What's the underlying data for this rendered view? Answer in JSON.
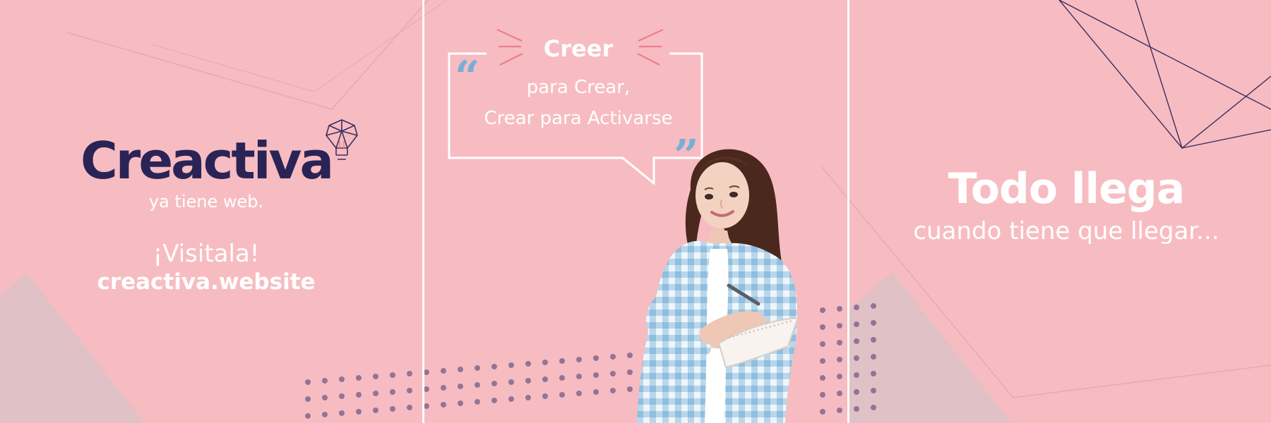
{
  "palette": {
    "background": "#f7bcc1",
    "brand": "#2a2456",
    "text": "#ffffff",
    "quote": "#78afd6",
    "dot": "#8a6d8f",
    "lines": "#3a2f5d"
  },
  "left_panel": {
    "brand": "Creactiva",
    "tagline": "ya tiene web.",
    "visit_label": "¡Visitala!",
    "visit_url": "creactiva.website",
    "logo_icon": "lightbulb-icon"
  },
  "center_panel": {
    "quote_title": "Creer",
    "quote_line_1": "para Crear,",
    "quote_line_2": "Crear para Activarse",
    "open_quote": "“",
    "close_quote": "”",
    "quote_icon": "quote-bubble-icon",
    "person_icon": "person-writing-illustration"
  },
  "right_panel": {
    "title": "Todo llega",
    "subtitle": "cuando tiene que llegar..."
  }
}
